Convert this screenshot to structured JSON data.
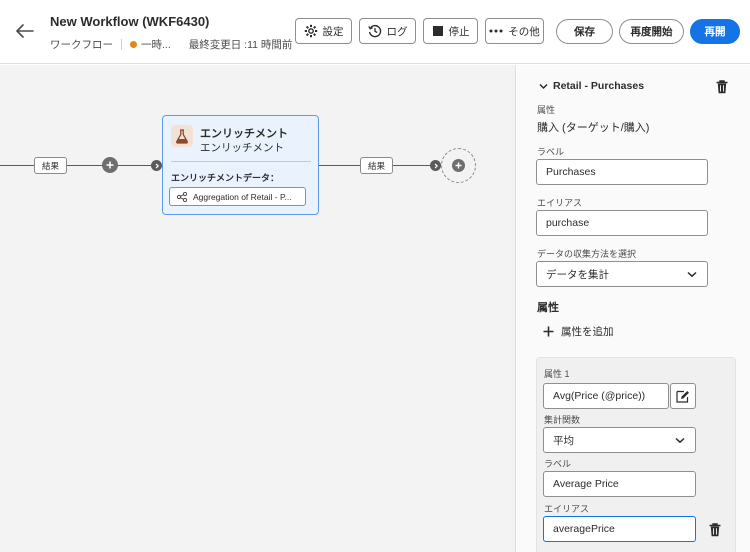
{
  "header": {
    "title": "New Workflow (WKF6430)",
    "type_label": "ワークフロー",
    "status_label": "一時...",
    "last_modified": "最終変更日 :11 時間前",
    "toolbar": {
      "settings_label": "設定",
      "log_label": "ログ",
      "stop_label": "停止",
      "more_label": "その他",
      "save_label": "保存",
      "restart_label": "再度開始",
      "resume_label": "再開"
    },
    "status_color": "#e68619",
    "primary_color": "#1473e6"
  },
  "canvas": {
    "left_chip": "結果",
    "right_chip": "結果",
    "node": {
      "title": "エンリッチメント",
      "subtitle": "エンリッチメント",
      "data_label": "エンリッチメントデータ：",
      "tag": "Aggregation of Retail - P..."
    }
  },
  "panel": {
    "title": "Retail - Purchases",
    "attribute_label": "属性",
    "attribute_value": "購入 (ターゲット/購入)",
    "label_label": "ラベル",
    "label_value": "Purchases",
    "alias_label": "エイリアス",
    "alias_value": "purchase",
    "collect_label": "データの収集方法を選択",
    "collect_value": "データを集計",
    "attributes_heading": "属性",
    "add_attribute": "属性を追加",
    "attr1": {
      "heading": "属性 1",
      "expression": "Avg(Price (@price))",
      "agg_label": "集計関数",
      "agg_value": "平均",
      "label_label": "ラベル",
      "label_value": "Average Price",
      "alias_label": "エイリアス",
      "alias_value": "averagePrice"
    }
  }
}
